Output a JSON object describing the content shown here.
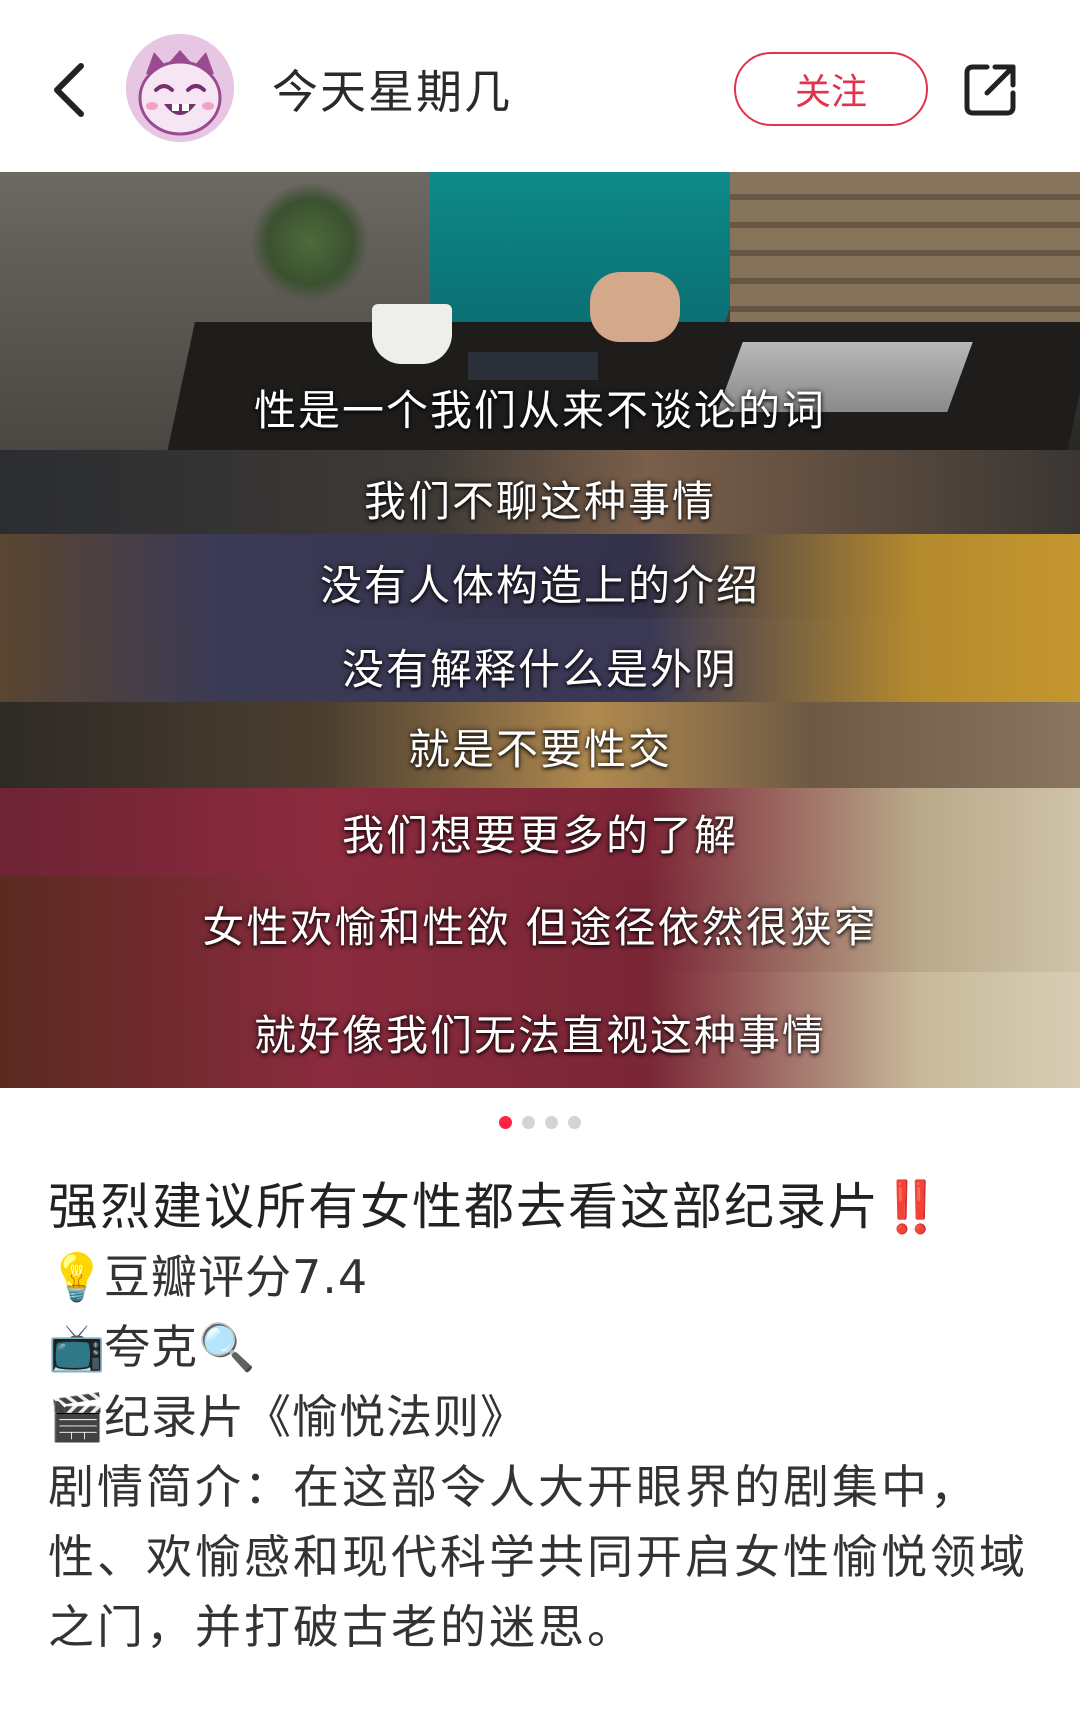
{
  "header": {
    "author_name": "今天星期几",
    "follow_label": "关注"
  },
  "carousel": {
    "subtitles": [
      "性是一个我们从来不谈论的词",
      "我们不聊这种事情",
      "没有人体构造上的介绍",
      "没有解释什么是外阴",
      "就是不要性交",
      "我们想要更多的了解",
      "女性欢愉和性欲  但途径依然很狭窄",
      "就好像我们无法直视这种事情"
    ],
    "page_count": 4,
    "active_page": 1
  },
  "post": {
    "title": "强烈建议所有女性都去看这部纪录片",
    "title_mark": "‼️",
    "rating_emoji": "💡",
    "rating_text": "豆瓣评分7.4",
    "platform_emoji": "📺",
    "platform_text": "夸克",
    "search_emoji": "🔍",
    "movie_emoji": "🎬",
    "movie_text": "纪录片《愉悦法则》",
    "synopsis": "剧情简介：在这部令人大开眼界的剧集中，性、欢愉感和现代科学共同开启女性愉悦领域之门，并打破古老的迷思。"
  },
  "colors": {
    "accent": "#e0334d",
    "dot_active": "#ff2442",
    "dot_inactive": "#d4d4d4"
  },
  "icons": [
    "back-arrow-icon",
    "avatar-cartoon-icon",
    "share-icon"
  ]
}
